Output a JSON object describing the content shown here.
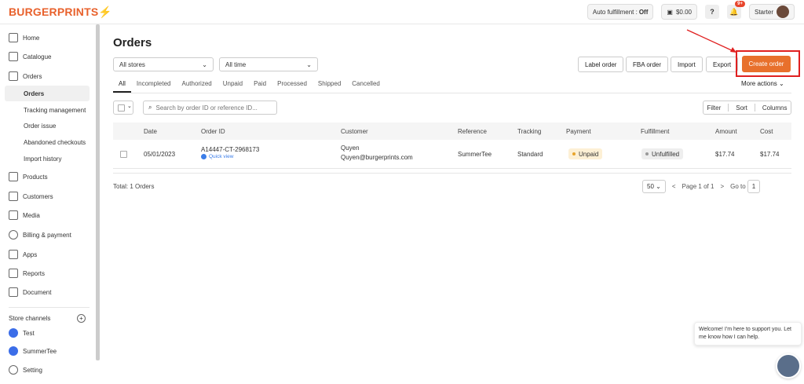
{
  "brand": {
    "logo": "BURGERPRINTS",
    "bolt": "⚡"
  },
  "topbar": {
    "auto_fulfillment_label": "Auto fulfillment :",
    "auto_fulfillment_value": "Off",
    "balance": "$0.00",
    "help": "?",
    "notif_badge": "9+",
    "plan": "Starter"
  },
  "sidebar": {
    "home": "Home",
    "catalogue": "Catalogue",
    "orders": "Orders",
    "orders_sub": [
      "Orders",
      "Tracking management",
      "Order issue",
      "Abandoned checkouts",
      "Import history"
    ],
    "products": "Products",
    "customers": "Customers",
    "media": "Media",
    "billing": "Billing & payment",
    "apps": "Apps",
    "reports": "Reports",
    "document": "Document",
    "store_channels": "Store channels",
    "stores": [
      "Test",
      "SummerTee"
    ],
    "setting": "Setting"
  },
  "page": {
    "title": "Orders",
    "store_filter": "All stores",
    "time_filter": "All time",
    "buttons": {
      "label_order": "Label order",
      "fba_order": "FBA order",
      "import": "Import",
      "export": "Export",
      "create_order": "Create order",
      "more_actions": "More actions"
    },
    "tabs": [
      "All",
      "Incompleted",
      "Authorized",
      "Unpaid",
      "Paid",
      "Processed",
      "Shipped",
      "Cancelled"
    ],
    "search_placeholder": "Search by order ID or reference ID...",
    "filter": "Filter",
    "sort": "Sort",
    "columns_btn": "Columns"
  },
  "table": {
    "columns": [
      "Date",
      "Order ID",
      "Customer",
      "Reference",
      "Tracking",
      "Payment",
      "Fulfillment",
      "Amount",
      "Cost"
    ],
    "rows": [
      {
        "date": "05/01/2023",
        "order_id": "A14447-CT-2968173",
        "quick_view": "Quick view",
        "customer_name": "Quyen",
        "customer_email": "Quyen@burgerprints.com",
        "reference": "SummerTee",
        "tracking": "Standard",
        "payment": "Unpaid",
        "fulfillment": "Unfulfilled",
        "amount": "$17.74",
        "cost": "$17.74"
      }
    ]
  },
  "footer": {
    "total": "Total: 1 Orders",
    "page_size": "50",
    "page_info": "Page 1 of 1",
    "goto_label": "Go to",
    "goto_value": "1"
  },
  "chat": {
    "message": "Welcome! I'm here to support you. Let me know how I can help."
  },
  "colors": {
    "accent": "#e8702c",
    "highlight": "#e02020",
    "link": "#3b7de8"
  }
}
